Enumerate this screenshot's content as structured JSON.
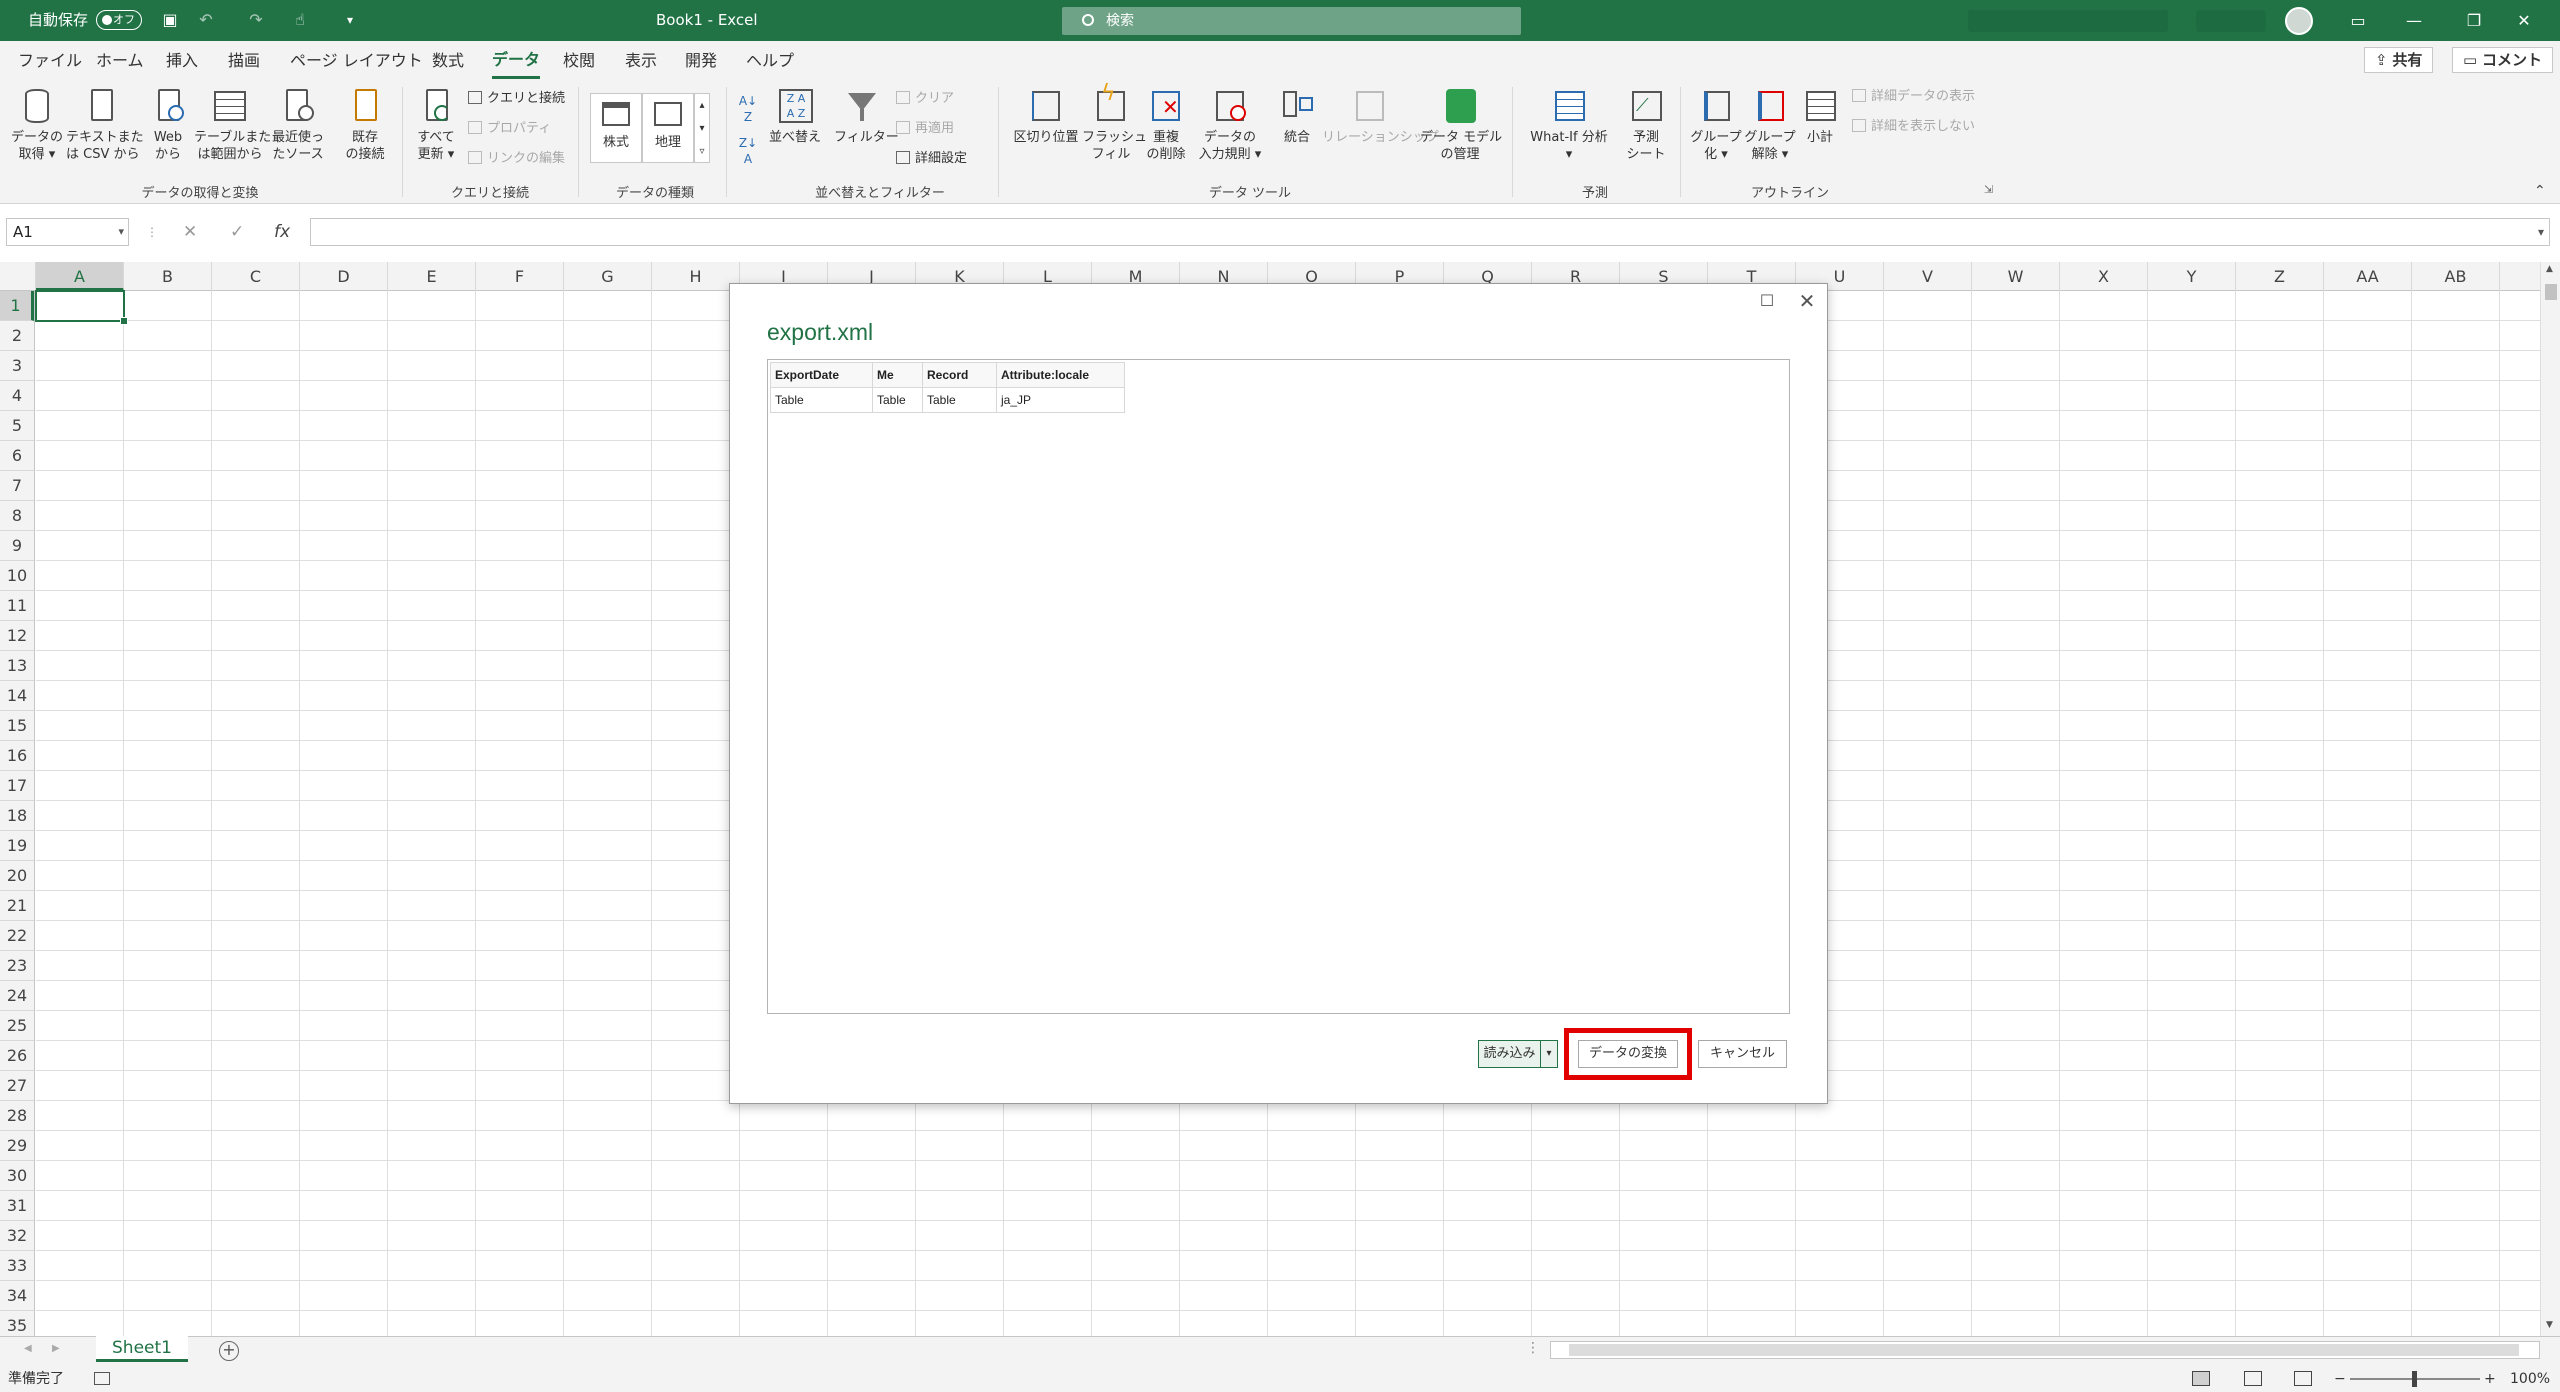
{
  "titlebar": {
    "autosave_label": "自動保存",
    "autosave_state": "オフ",
    "doc_title": "Book1  -  Excel",
    "search_placeholder": "検索"
  },
  "menu": {
    "tabs": [
      "ファイル",
      "ホーム",
      "挿入",
      "描画",
      "ページ レイアウト",
      "数式",
      "データ",
      "校閲",
      "表示",
      "開発",
      "ヘルプ"
    ],
    "active": "データ",
    "share": "共有",
    "comment": "コメント"
  },
  "ribbon": {
    "get_data": "データの\n取得 ▾",
    "text_csv": "テキストまた\nは CSV から",
    "web": "Web\nから",
    "table_range": "テーブルまた\nは範囲から",
    "recent": "最近使っ\nたソース",
    "existing": "既存\nの接続",
    "group1": "データの取得と変換",
    "refresh_all": "すべて\n更新 ▾",
    "queries": "クエリと接続",
    "properties": "プロパティ",
    "edit_links": "リンクの編集",
    "group2": "クエリと接続",
    "stocks": "株式",
    "geography": "地理",
    "group3": "データの種類",
    "sort": "並べ替え",
    "filter": "フィルター",
    "clear": "クリア",
    "reapply": "再適用",
    "advanced": "詳細設定",
    "group4": "並べ替えとフィルター",
    "text_to_columns": "区切り位置",
    "flash_fill": "フラッシュ\nフィル",
    "remove_dup": "重複\nの削除",
    "validation": "データの\n入力規則 ▾",
    "consolidate": "統合",
    "relationships": "リレーションシップ",
    "data_model": "データ モデル\nの管理",
    "group5": "データ ツール",
    "whatif": "What-If 分析\n▾",
    "forecast": "予測\nシート",
    "group6": "予測",
    "group_btn": "グループ\n化 ▾",
    "ungroup_btn": "グループ\n解除 ▾",
    "subtotal": "小計",
    "show_detail": "詳細データの表示",
    "hide_detail": "詳細を表示しない",
    "group7": "アウトライン"
  },
  "formula": {
    "namebox": "A1",
    "cancel": "✕",
    "enter": "✓",
    "fx": "fx",
    "value": ""
  },
  "columns": [
    "A",
    "B",
    "C",
    "D",
    "E",
    "F",
    "G",
    "H",
    "I",
    "J",
    "K",
    "L",
    "M",
    "N",
    "O",
    "P",
    "Q",
    "R",
    "S",
    "T",
    "U",
    "V",
    "W",
    "X",
    "Y",
    "Z",
    "AA",
    "AB"
  ],
  "rows": [
    "1",
    "2",
    "3",
    "4",
    "5",
    "6",
    "7",
    "8",
    "9",
    "10",
    "11",
    "12",
    "13",
    "14",
    "15",
    "16",
    "17",
    "18",
    "19",
    "20",
    "21",
    "22",
    "23",
    "24",
    "25",
    "26",
    "27",
    "28",
    "29",
    "30",
    "31",
    "32",
    "33",
    "34",
    "35"
  ],
  "sheet": {
    "tab": "Sheet1",
    "add": "+"
  },
  "status": {
    "ready": "準備完了",
    "zoom": "100%"
  },
  "dialog": {
    "title": "export.xml",
    "headers": [
      "ExportDate",
      "Me",
      "Record",
      "Attribute:locale"
    ],
    "rows": [
      [
        "Table",
        "Table",
        "Table",
        "ja_JP"
      ]
    ],
    "load_label": "読み込み",
    "transform_label": "データの変換",
    "cancel_label": "キャンセル"
  },
  "colors": {
    "accent": "#217346",
    "highlight": "#e00000"
  }
}
